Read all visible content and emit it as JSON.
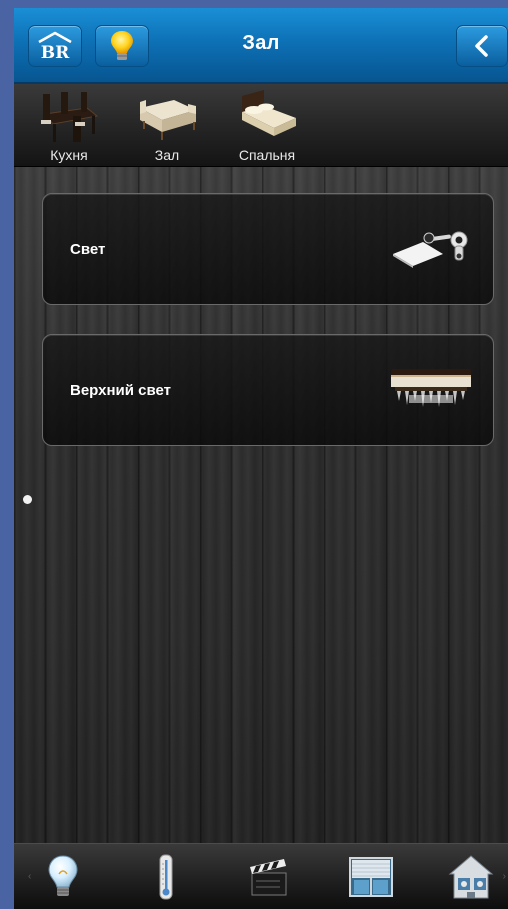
{
  "header": {
    "title": "Зал",
    "home_icon": "home-logo-icon",
    "bulb_icon": "lightbulb-icon",
    "back_icon": "chevron-left-icon"
  },
  "rooms": [
    {
      "label": "Кухня",
      "icon": "dining-table-icon"
    },
    {
      "label": "Зал",
      "icon": "sofa-icon"
    },
    {
      "label": "Спальня",
      "icon": "bed-icon"
    }
  ],
  "devices": [
    {
      "label": "Свет",
      "icon": "spotlight-icon"
    },
    {
      "label": "Верхний свет",
      "icon": "chandelier-icon"
    }
  ],
  "pager": {
    "pages": 1,
    "current": 1
  },
  "bottom_nav": [
    {
      "icon": "lightbulb-icon"
    },
    {
      "icon": "thermometer-icon"
    },
    {
      "icon": "clapperboard-icon"
    },
    {
      "icon": "window-blinds-icon"
    },
    {
      "icon": "house-settings-icon"
    }
  ],
  "colors": {
    "header_blue": "#0d6fb4",
    "frame_blue": "#4a63a3",
    "card_border": "#6a6a6a",
    "text": "#ffffff"
  }
}
